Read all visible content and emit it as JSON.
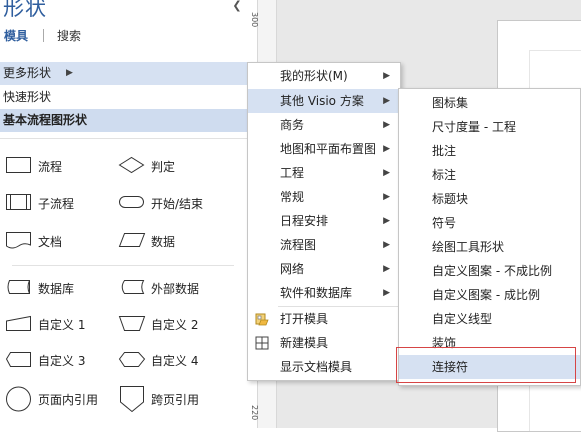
{
  "pane": {
    "title": "形状",
    "tab_stencils": "模具",
    "tab_search": "搜索",
    "more_shapes": "更多形状",
    "quick_shapes": "快速形状",
    "basic_flowchart": "基本流程图形状"
  },
  "shapes": [
    {
      "label": "流程",
      "icon": "process-icon"
    },
    {
      "label": "判定",
      "icon": "decision-icon"
    },
    {
      "label": "子流程",
      "icon": "subprocess-icon"
    },
    {
      "label": "开始/结束",
      "icon": "start-end-icon"
    },
    {
      "label": "文档",
      "icon": "document-icon"
    },
    {
      "label": "数据",
      "icon": "data-icon"
    },
    {
      "label": "数据库",
      "icon": "database-icon"
    },
    {
      "label": "外部数据",
      "icon": "external-data-icon"
    },
    {
      "label": "自定义 1",
      "icon": "custom1-icon"
    },
    {
      "label": "自定义 2",
      "icon": "custom2-icon"
    },
    {
      "label": "自定义 3",
      "icon": "custom3-icon"
    },
    {
      "label": "自定义 4",
      "icon": "custom4-icon"
    },
    {
      "label": "页面内引用",
      "icon": "on-page-reference-icon"
    },
    {
      "label": "跨页引用",
      "icon": "off-page-reference-icon"
    }
  ],
  "ruler": {
    "top": "300",
    "bottom": "220"
  },
  "menu_more": [
    {
      "label": "我的形状(M)",
      "submenu": true
    },
    {
      "label": "其他 Visio 方案",
      "submenu": true,
      "highlighted": true
    },
    {
      "label": "商务",
      "submenu": true
    },
    {
      "label": "地图和平面布置图",
      "submenu": true
    },
    {
      "label": "工程",
      "submenu": true
    },
    {
      "label": "常规",
      "submenu": true
    },
    {
      "label": "日程安排",
      "submenu": true
    },
    {
      "label": "流程图",
      "submenu": true
    },
    {
      "label": "网络",
      "submenu": true
    },
    {
      "label": "软件和数据库",
      "submenu": true
    },
    {
      "label": "打开模具",
      "icon": "open-stencil-icon"
    },
    {
      "label": "新建模具",
      "icon": "new-stencil-icon"
    },
    {
      "label": "显示文档模具"
    }
  ],
  "menu_visio": [
    {
      "label": "图标集"
    },
    {
      "label": "尺寸度量 - 工程"
    },
    {
      "label": "批注"
    },
    {
      "label": "标注"
    },
    {
      "label": "标题块"
    },
    {
      "label": "符号"
    },
    {
      "label": "绘图工具形状"
    },
    {
      "label": "自定义图案 - 不成比例"
    },
    {
      "label": "自定义图案 - 成比例"
    },
    {
      "label": "自定义线型"
    },
    {
      "label": "装饰"
    },
    {
      "label": "连接符",
      "highlighted": true
    }
  ],
  "colors": {
    "highlight": "#d6e1f2",
    "title_blue": "#2f5e9e",
    "annotation_red": "#d64545"
  }
}
